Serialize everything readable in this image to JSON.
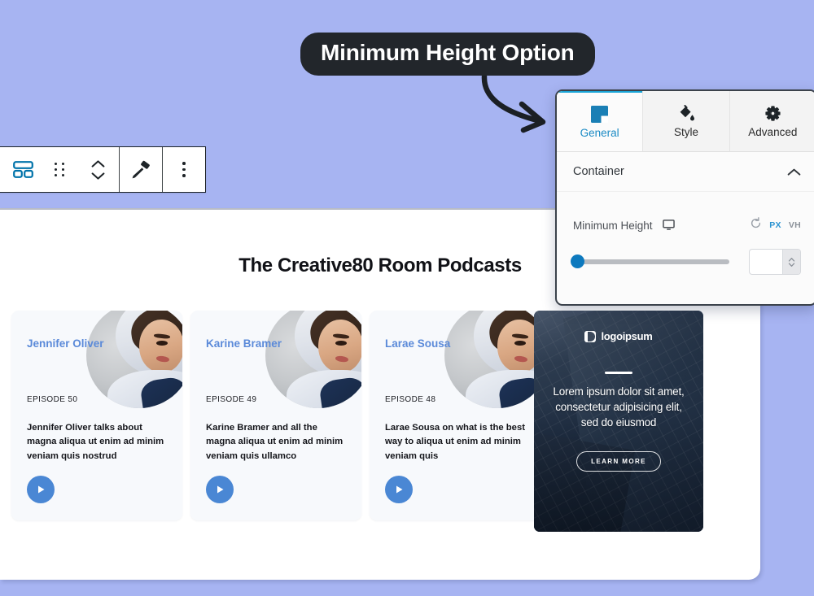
{
  "background_color": "#a7b4f2",
  "callout": {
    "text": "Minimum Height Option"
  },
  "toolbar": {
    "block_type_label": "container-block",
    "drag_label": "drag-handle",
    "move_up_label": "move-up",
    "move_down_label": "move-down",
    "stamp_label": "style-paste",
    "more_label": "more-options"
  },
  "canvas": {
    "title": "The Creative80 Room Podcasts",
    "cards": [
      {
        "host": "Jennifer Oliver",
        "episode": "EPISODE 50",
        "description": "Jennifer Oliver talks about magna aliqua ut enim ad minim veniam quis nostrud",
        "play_label": "play"
      },
      {
        "host": "Karine Bramer",
        "episode": "EPISODE 49",
        "description": "Karine Bramer and all the magna aliqua ut enim ad minim veniam quis ullamco",
        "play_label": "play"
      },
      {
        "host": "Larae Sousa",
        "episode": "EPISODE 48",
        "description": "Larae Sousa on what is the best way to aliqua ut enim ad minim veniam quis",
        "play_label": "play"
      }
    ],
    "promo": {
      "brand": "logoipsum",
      "text": "Lorem ipsum dolor sit amet, consectetur adipisicing elit, sed do eiusmod",
      "button": "LEARN MORE"
    }
  },
  "panel": {
    "tabs": [
      {
        "label": "General",
        "icon": "layout-icon",
        "active": true
      },
      {
        "label": "Style",
        "icon": "paint-bucket-icon",
        "active": false
      },
      {
        "label": "Advanced",
        "icon": "gear-icon",
        "active": false
      }
    ],
    "section": {
      "title": "Container",
      "collapse_icon": "chevron-up-icon"
    },
    "control": {
      "label": "Minimum Height",
      "device_icon": "desktop-icon",
      "reset_icon": "reset-icon",
      "units": [
        {
          "label": "PX",
          "active": true
        },
        {
          "label": "VH",
          "active": false
        }
      ],
      "slider_value": 0,
      "input_value": "",
      "input_placeholder": ""
    },
    "accent_color": "#2a93d1"
  }
}
